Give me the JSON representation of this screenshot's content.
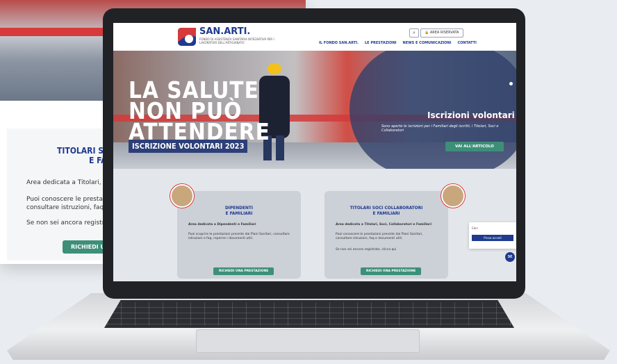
{
  "background_page": {
    "title_line1": "TITOLARI SOCI",
    "title_line2": "E FAM",
    "text1": "Area dedicata a Titolari, Soci, C",
    "text2": "Puoi conoscere le prestazioni pr",
    "text3": "consultare istruzioni, faq e docu",
    "text4": "Se non sei ancora registrato, cli",
    "button": "RICHIEDI UNA"
  },
  "header": {
    "brand": "SAN.ARTI.",
    "brand_sub": "FONDO DI ASSISTENZA SANITARIA INTEGRATIVA PER I LAVORATORI DELL'ARTIGIANATO",
    "search_icon": "search-icon",
    "area_button": "AREA RISERVATA",
    "nav": [
      "IL FONDO SAN.ARTI.",
      "LE PRESTAZIONI",
      "NEWS E COMUNICAZIONI",
      "CONTATTI"
    ]
  },
  "hero": {
    "big_title": [
      "LA SALUTE",
      "NON PUÒ",
      "ATTENDERE"
    ],
    "ribbon": "ISCRIZIONE VOLONTARI 2023",
    "title": "Iscrizioni volontari",
    "subtitle": "Sono aperte le iscrizioni per i Familiari degli iscritti, i Titolari, Soci e Collaboratori",
    "button": "VAI ALL'ARTICOLO"
  },
  "cards": [
    {
      "title_line1": "DIPENDENTI",
      "title_line2": "E FAMILIARI",
      "text1": "Area dedicata a Dipendenti e Familiari",
      "text2": "Puoi scoprire le prestazioni previste dai Piani Sanitari, consultare istruzioni e faq, reperire i documenti utili.",
      "text3": "",
      "button": "RICHIEDI UNA PRESTAZIONE"
    },
    {
      "title_line1": "TITOLARI SOCI COLLABORATORI",
      "title_line2": "E FAMILIARI",
      "text1": "Area dedicata a Titolari, Soci, Collaboratori e Familiari",
      "text2": "Puoi conoscere le prestazioni previste dai Piani Sanitari, consultare istruzioni, faq e documenti utili.",
      "text3": "Se non sei ancora registrato, clicca qui",
      "button": "RICHIEDI UNA PRESTAZIONE"
    }
  ],
  "login": {
    "label": "Cerc",
    "button": "Prova accedi"
  },
  "chat": {
    "icon": "chat-icon"
  }
}
